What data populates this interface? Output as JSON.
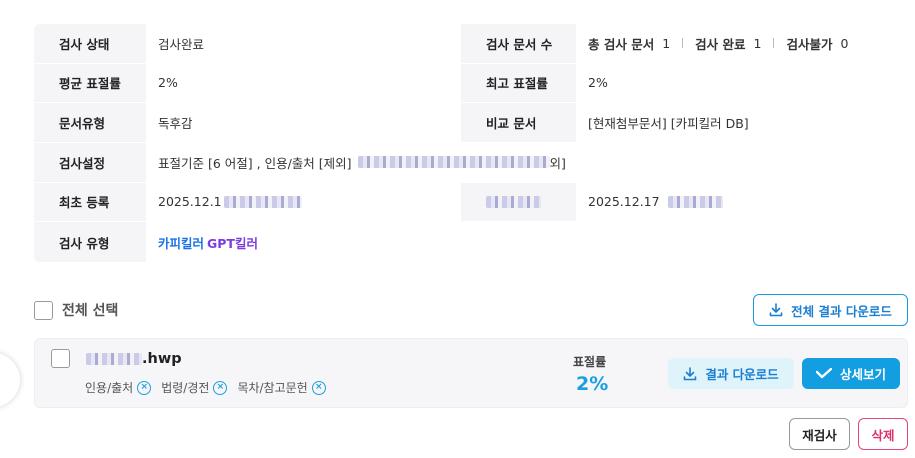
{
  "info": {
    "status_label": "검사 상태",
    "status_value": "검사완료",
    "doc_count_label": "검사 문서 수",
    "total_label": "총 검사 문서",
    "total_value": "1",
    "done_label": "검사 완료",
    "done_value": "1",
    "fail_label": "검사불가",
    "fail_value": "0",
    "avg_label": "평균 표절률",
    "avg_value": "2%",
    "max_label": "최고 표절률",
    "max_value": "2%",
    "doc_type_label": "문서유형",
    "doc_type_value": "독후감",
    "compare_label": "비교 문서",
    "compare_value": "[현재첨부문서] [카피킬러 DB]",
    "settings_label": "검사설정",
    "settings_value_prefix": "표절기준 [6 어절] , 인용/출처 [제외]",
    "settings_value_suffix": "외]",
    "first_reg_label": "최초 등록",
    "first_reg_value": "2025.12.1",
    "right_reg_value": "2025.12.17",
    "kind_label": "검사 유형",
    "kind_a": "카피킬러",
    "kind_b": "GPT킬러"
  },
  "select_all_label": "전체 선택",
  "download_all_label": "전체 결과 다운로드",
  "file": {
    "name_suffix": "hwp",
    "tags": [
      "인용/출처",
      "법령/경전",
      "목차/참고문헌"
    ],
    "ratio_label": "표절률",
    "ratio_value": "2%",
    "download_label": "결과 다운로드",
    "detail_label": "상세보기"
  },
  "recheck_label": "재검사",
  "delete_label": "삭제",
  "colors": {
    "accent_blue": "#129ee0",
    "gpt_purple": "#7b3ce0",
    "delete_pink": "#e0306b"
  },
  "icons": [
    "download-icon",
    "check-icon",
    "close-circle-icon"
  ]
}
